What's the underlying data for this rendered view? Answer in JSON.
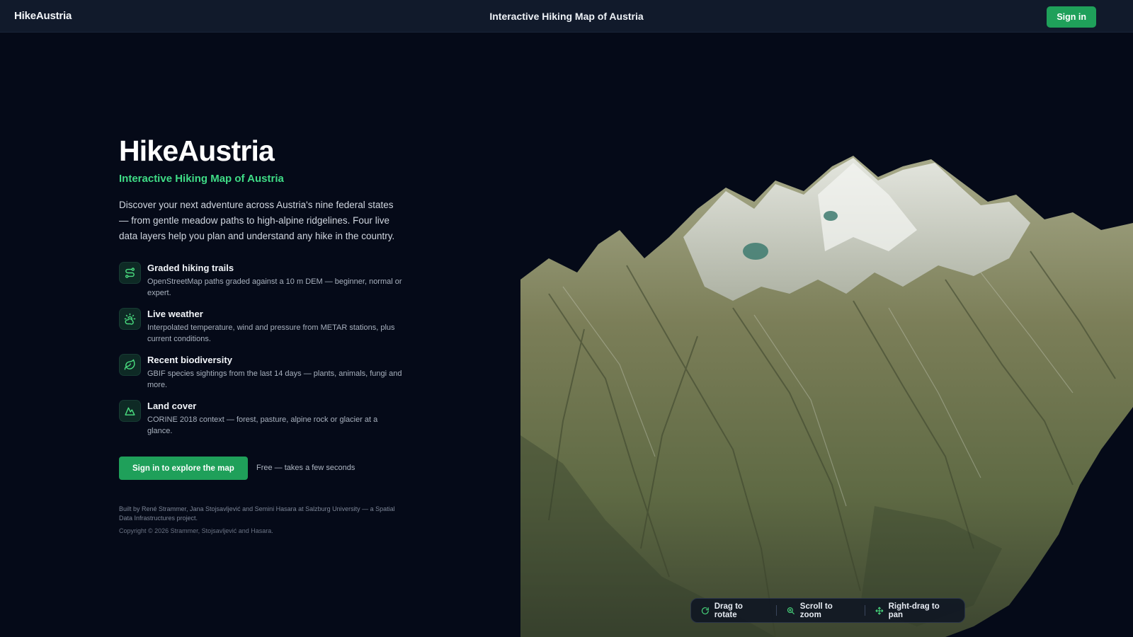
{
  "header": {
    "brand": "HikeAustria",
    "title": "Interactive Hiking Map of Austria",
    "signin_label": "Sign in"
  },
  "hero": {
    "title": "HikeAustria",
    "subtitle": "Interactive Hiking Map of Austria",
    "description": "Discover your next adventure across Austria's nine federal states — from gentle meadow paths to high-alpine ridgelines. Four live data layers help you plan and understand any hike in the country."
  },
  "features": [
    {
      "icon": "route-icon",
      "title": "Graded hiking trails",
      "description": "OpenStreetMap paths graded against a 10 m DEM — beginner, normal or expert."
    },
    {
      "icon": "weather-icon",
      "title": "Live weather",
      "description": "Interpolated temperature, wind and pressure from METAR stations, plus current conditions."
    },
    {
      "icon": "leaf-icon",
      "title": "Recent biodiversity",
      "description": "GBIF species sightings from the last 14 days — plants, animals, fungi and more."
    },
    {
      "icon": "mountain-icon",
      "title": "Land cover",
      "description": "CORINE 2018 context — forest, pasture, alpine rock or glacier at a glance."
    }
  ],
  "cta": {
    "button_label": "Sign in to explore the map",
    "note": "Free — takes a few seconds"
  },
  "footer": {
    "credits": "Built by René Strammer, Jana Stojsavljević and Semini Hasara at Salzburg University — a Spatial Data Infrastructures project.",
    "copyright": "Copyright © 2026 Strammer, Stojsavljević and Hasara."
  },
  "map_controls": [
    {
      "icon": "rotate-icon",
      "label": "Drag to rotate"
    },
    {
      "icon": "zoom-icon",
      "label": "Scroll to zoom"
    },
    {
      "icon": "pan-icon",
      "label": "Right-drag to pan"
    }
  ],
  "colors": {
    "background": "#050a18",
    "topbar": "#111a2b",
    "accent": "#1fa05a",
    "subtitle_green": "#3fdc86"
  }
}
